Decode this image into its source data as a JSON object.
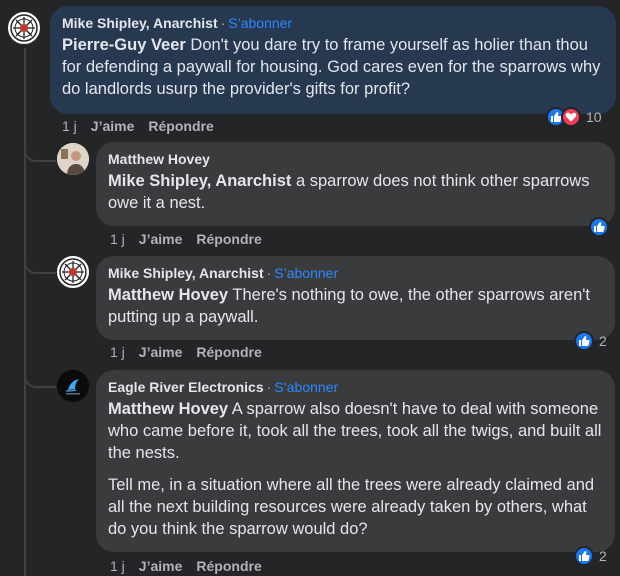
{
  "comments": [
    {
      "author": "Mike Shipley, Anarchist",
      "follow": "S’abonner",
      "mention": "Pierre-Guy Veer",
      "text": "Don't you dare try to frame yourself as holier than thou for defending a paywall for housing. God cares even for the sparrows why do landlords usurp the provider's gifts for profit?",
      "time": "1 j",
      "like": "J’aime",
      "reply": "Répondre",
      "reaction_count": "10"
    },
    {
      "author": "Matthew Hovey",
      "mention": "Mike Shipley, Anarchist",
      "text": "a sparrow does not think other sparrows owe it a nest.",
      "time": "1 j",
      "like": "J’aime",
      "reply": "Répondre"
    },
    {
      "author": "Mike Shipley, Anarchist",
      "follow": "S’abonner",
      "mention": "Matthew Hovey",
      "text": "There's nothing to owe, the other sparrows aren't putting up a paywall.",
      "time": "1 j",
      "like": "J’aime",
      "reply": "Répondre",
      "reaction_count": "2"
    },
    {
      "author": "Eagle River Electronics",
      "follow": "S’abonner",
      "mention": "Matthew Hovey",
      "text": "A sparrow also doesn't have to deal with someone who came before it, took all the trees, took all the twigs, and built all the nests.",
      "text2": "Tell me, in a situation where all the trees were already claimed and all the next building resources were already taken by others, what do you think the sparrow would do?",
      "time": "1 j",
      "like": "J’aime",
      "reply": "Répondre",
      "reaction_count": "2"
    }
  ],
  "colors": {
    "background": "#242526",
    "bubble": "#3a3b3c",
    "highlight_bubble": "#263951",
    "link_blue": "#2d88ff",
    "like_blue": "#1877f2",
    "love_red": "#f33e58"
  }
}
